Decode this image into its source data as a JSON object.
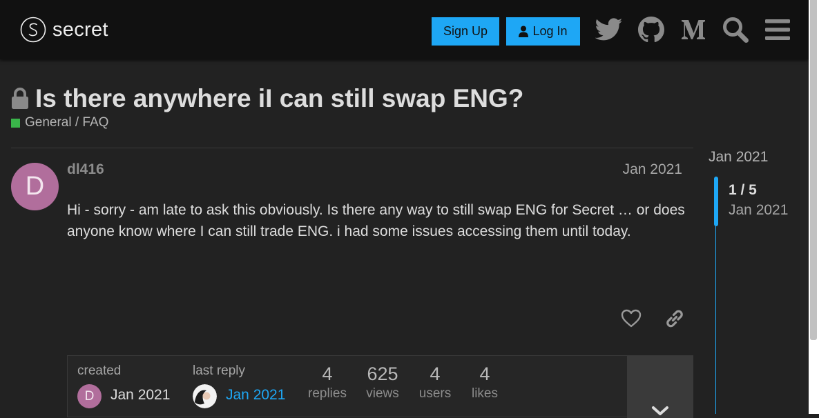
{
  "header": {
    "logo_text": "secret",
    "signup_label": "Sign Up",
    "login_label": "Log In",
    "icons": [
      "twitter-icon",
      "github-icon",
      "medium-icon",
      "search-icon",
      "hamburger-menu-icon"
    ]
  },
  "topic": {
    "title": "Is there anywhere iI can still swap ENG?",
    "category": "General / FAQ",
    "category_color": "#3ab54a"
  },
  "post": {
    "avatar_letter": "D",
    "username": "dl416",
    "date": "Jan 2021",
    "body": "Hi - sorry - am late to ask this obviously. Is there any way to still swap ENG for Secret … or does anyone know where I can still trade ENG. i had some issues accessing them until today."
  },
  "topic_map": {
    "created_label": "created",
    "created_avatar": "D",
    "created_date": "Jan 2021",
    "last_reply_label": "last reply",
    "last_reply_date": "Jan 2021",
    "stats": [
      {
        "num": "4",
        "label": "replies"
      },
      {
        "num": "625",
        "label": "views"
      },
      {
        "num": "4",
        "label": "users"
      },
      {
        "num": "4",
        "label": "likes"
      }
    ]
  },
  "timeline": {
    "top_date": "Jan 2021",
    "count": "1 / 5",
    "date": "Jan 2021"
  },
  "colors": {
    "accent": "#1ea7f5",
    "background": "#222222",
    "header": "#111111"
  }
}
